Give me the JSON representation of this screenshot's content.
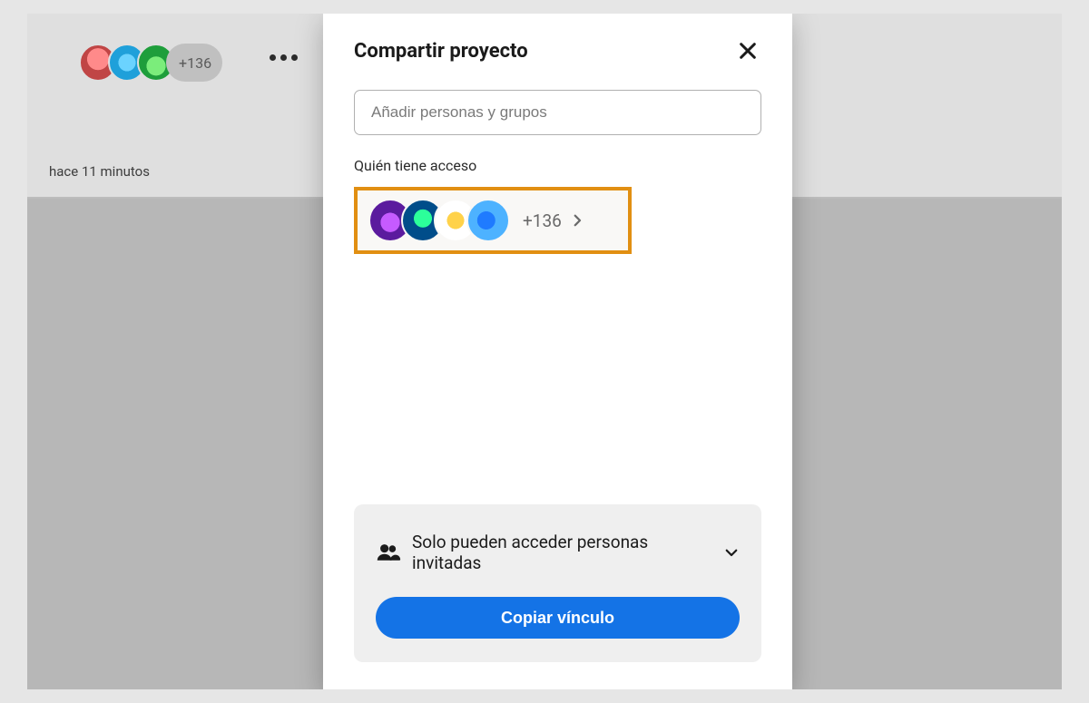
{
  "background": {
    "avatar_overflow": "+136",
    "timestamp": "hace 11 minutos"
  },
  "dialog": {
    "title": "Compartir proyecto",
    "add_placeholder": "Añadir personas y grupos",
    "access_label": "Quién tiene acceso",
    "access_overflow": "+136",
    "link_scope_text": "Solo pueden acceder personas invitadas",
    "copy_button": "Copiar vínculo"
  }
}
